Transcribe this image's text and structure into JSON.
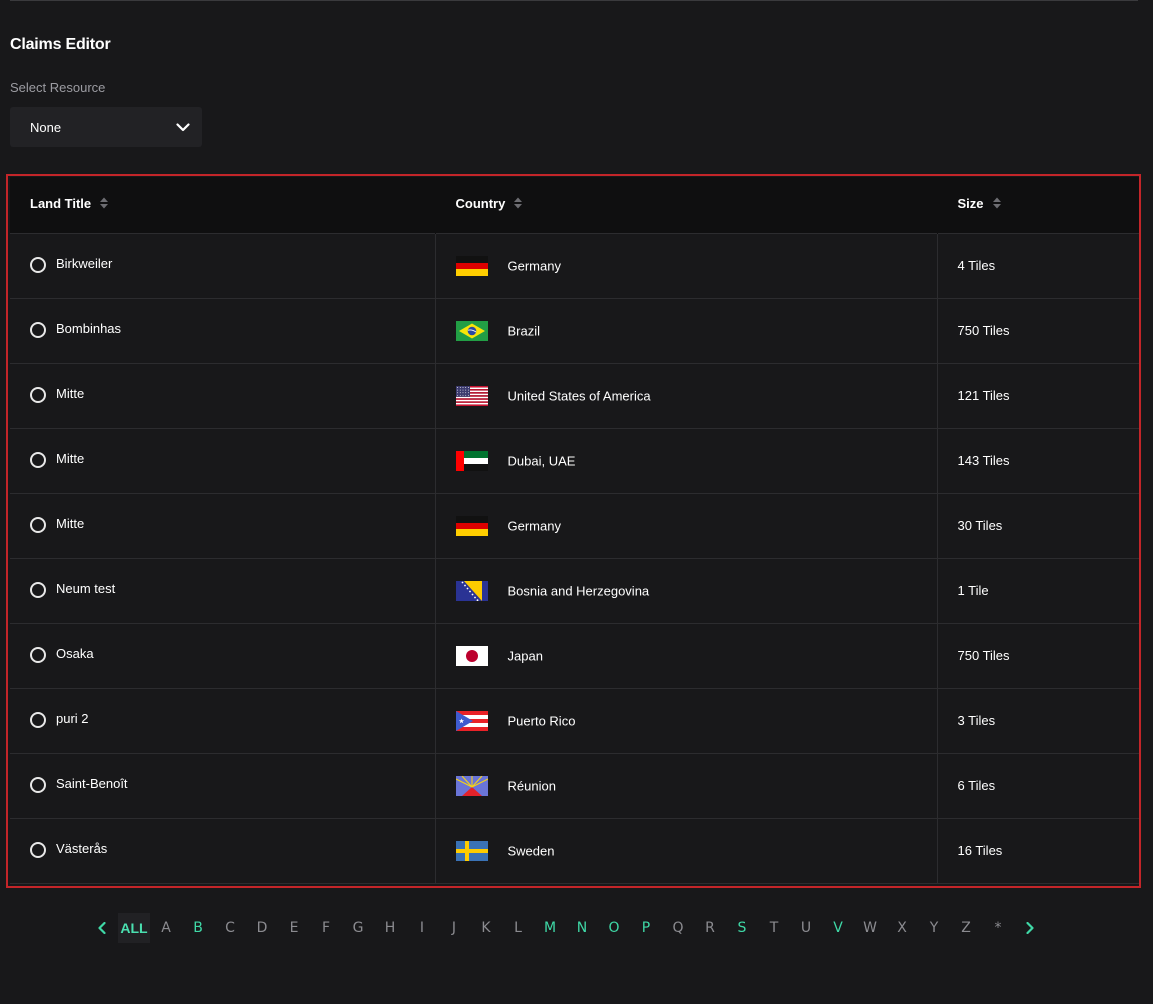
{
  "page": {
    "title": "Claims Editor"
  },
  "resource_select": {
    "label": "Select Resource",
    "value": "None"
  },
  "table": {
    "columns": [
      "Land Title",
      "Country",
      "Size"
    ],
    "rows": [
      {
        "title": "Birkweiler",
        "country": "Germany",
        "flag": "de",
        "size": "4 Tiles"
      },
      {
        "title": "Bombinhas",
        "country": "Brazil",
        "flag": "br",
        "size": "750 Tiles"
      },
      {
        "title": "Mitte",
        "country": "United States of America",
        "flag": "us",
        "size": "121 Tiles"
      },
      {
        "title": "Mitte",
        "country": "Dubai, UAE",
        "flag": "ae",
        "size": "143 Tiles"
      },
      {
        "title": "Mitte",
        "country": "Germany",
        "flag": "de",
        "size": "30 Tiles"
      },
      {
        "title": "Neum test",
        "country": "Bosnia and Herzegovina",
        "flag": "ba",
        "size": "1 Tile"
      },
      {
        "title": "Osaka",
        "country": "Japan",
        "flag": "jp",
        "size": "750 Tiles"
      },
      {
        "title": "puri 2",
        "country": "Puerto Rico",
        "flag": "pr",
        "size": "3 Tiles"
      },
      {
        "title": "Saint-Benoît",
        "country": "Réunion",
        "flag": "re",
        "size": "6 Tiles"
      },
      {
        "title": "Västerås",
        "country": "Sweden",
        "flag": "se",
        "size": "16 Tiles"
      }
    ]
  },
  "pagination": {
    "letters": [
      "ALL",
      "A",
      "B",
      "C",
      "D",
      "E",
      "F",
      "G",
      "H",
      "I",
      "J",
      "K",
      "L",
      "M",
      "N",
      "O",
      "P",
      "Q",
      "R",
      "S",
      "T",
      "U",
      "V",
      "W",
      "X",
      "Y",
      "Z",
      "*"
    ],
    "selected": "ALL",
    "active_letters": [
      "B",
      "M",
      "N",
      "O",
      "P",
      "S",
      "V"
    ]
  },
  "colors": {
    "accent": "#3fd9a7",
    "highlight_border": "#c32529",
    "background": "#18181a"
  }
}
